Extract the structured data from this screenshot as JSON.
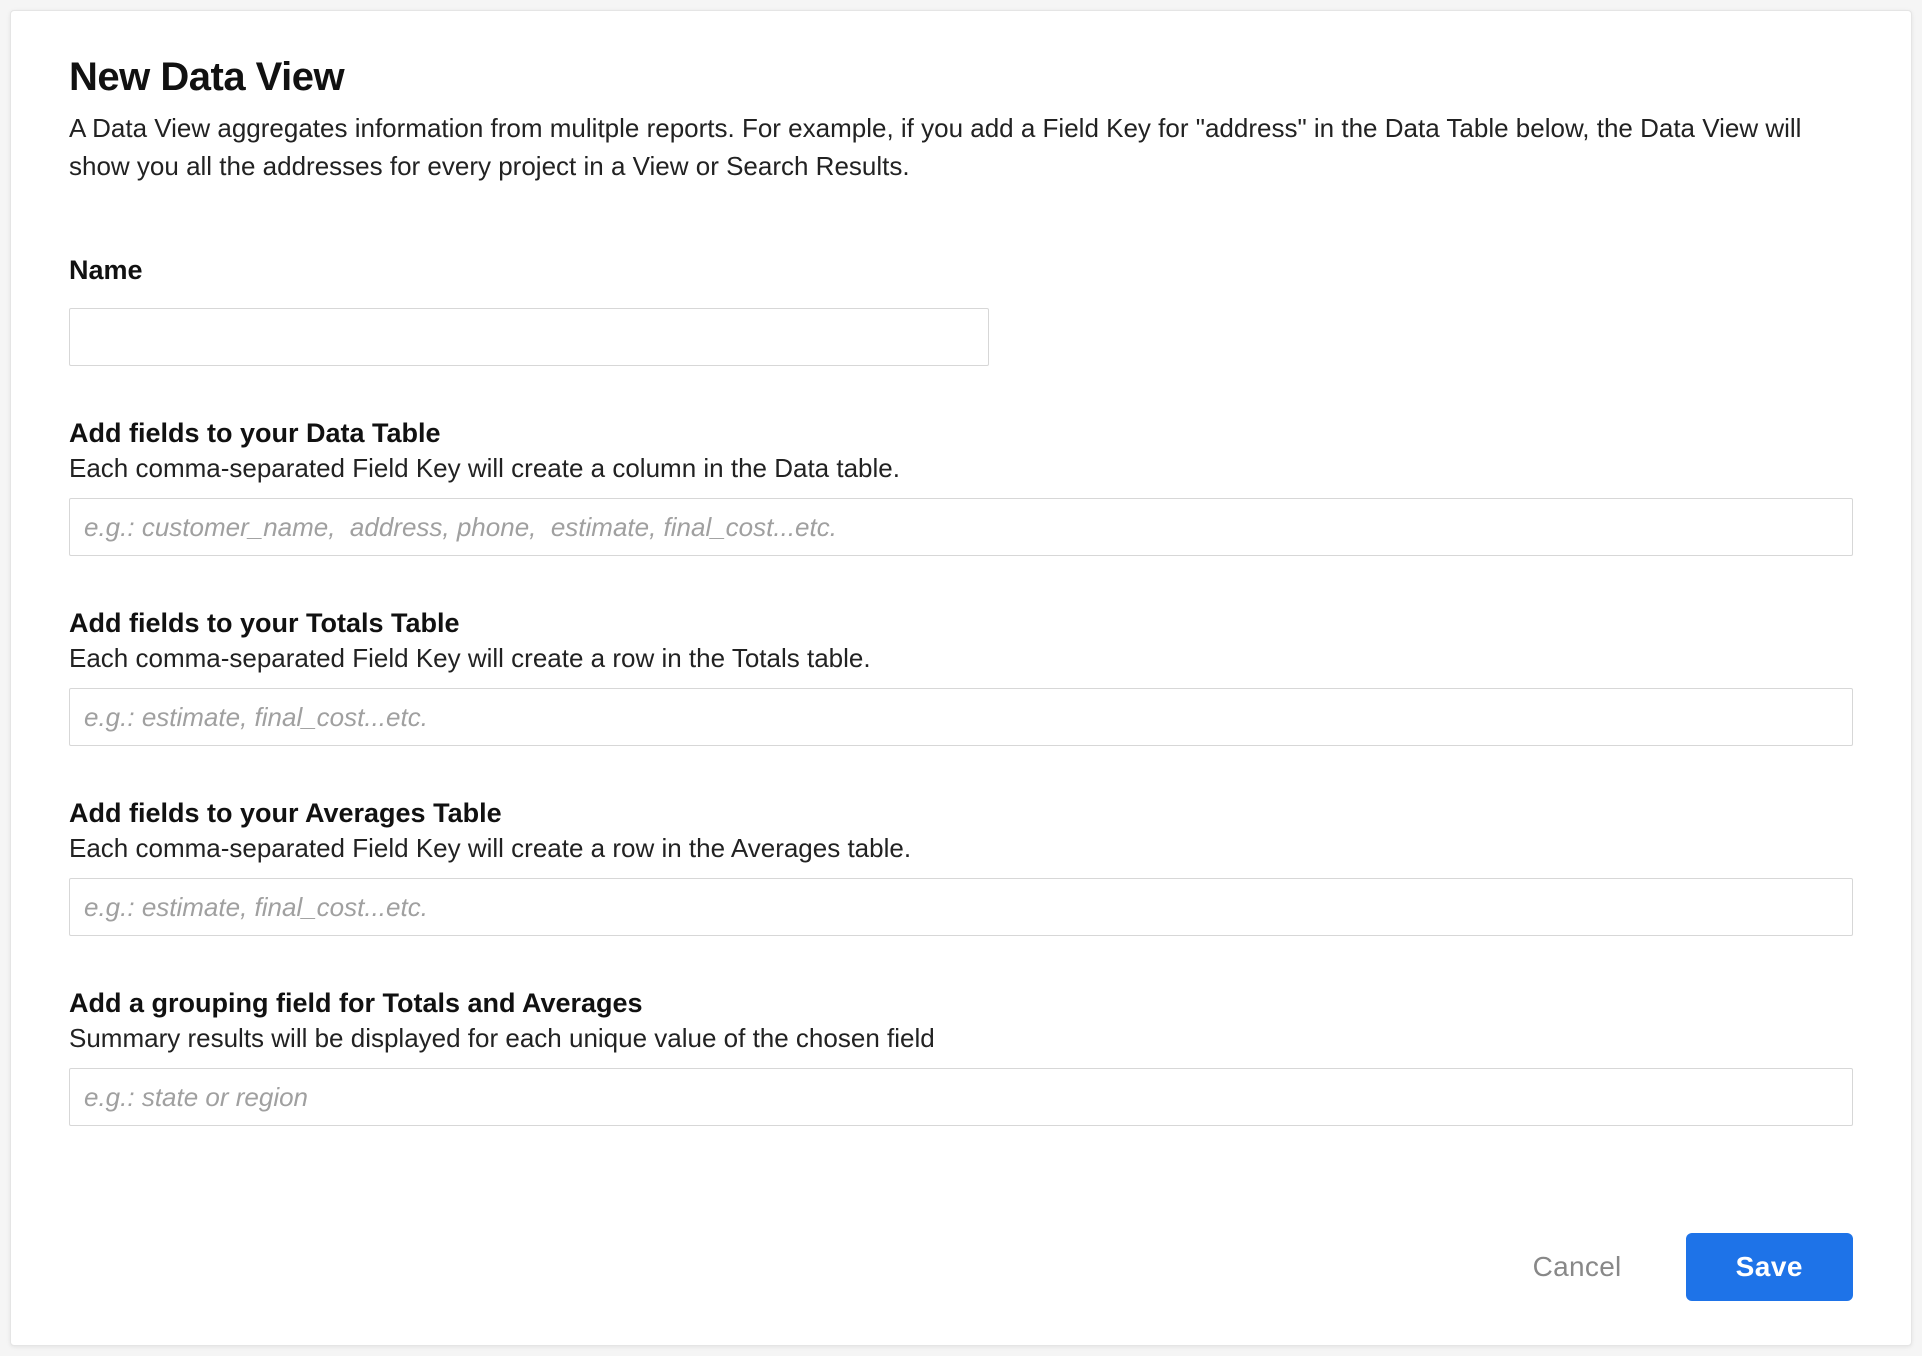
{
  "header": {
    "title": "New Data View",
    "subtitle": "A Data View aggregates information from mulitple reports. For example, if you add a Field Key for \"address\" in the Data Table below, the Data View will show you all the addresses for every project in a View or Search Results."
  },
  "fields": {
    "name": {
      "label": "Name",
      "value": ""
    },
    "data_table": {
      "label": "Add fields to your Data Table",
      "help": "Each comma-separated Field Key will create a column in the Data table.",
      "placeholder": "e.g.: customer_name,  address, phone,  estimate, final_cost...etc.",
      "value": ""
    },
    "totals_table": {
      "label": "Add fields to your Totals Table",
      "help": "Each comma-separated Field Key will create a row in the Totals table.",
      "placeholder": "e.g.: estimate, final_cost...etc.",
      "value": ""
    },
    "averages_table": {
      "label": "Add fields to your Averages Table",
      "help": "Each comma-separated Field Key will create a row in the Averages table.",
      "placeholder": "e.g.: estimate, final_cost...etc.",
      "value": ""
    },
    "grouping": {
      "label": "Add a grouping field for Totals and Averages",
      "help": "Summary results will be displayed for each unique value of the chosen field",
      "placeholder": "e.g.: state or region",
      "value": ""
    }
  },
  "footer": {
    "cancel": "Cancel",
    "save": "Save"
  }
}
